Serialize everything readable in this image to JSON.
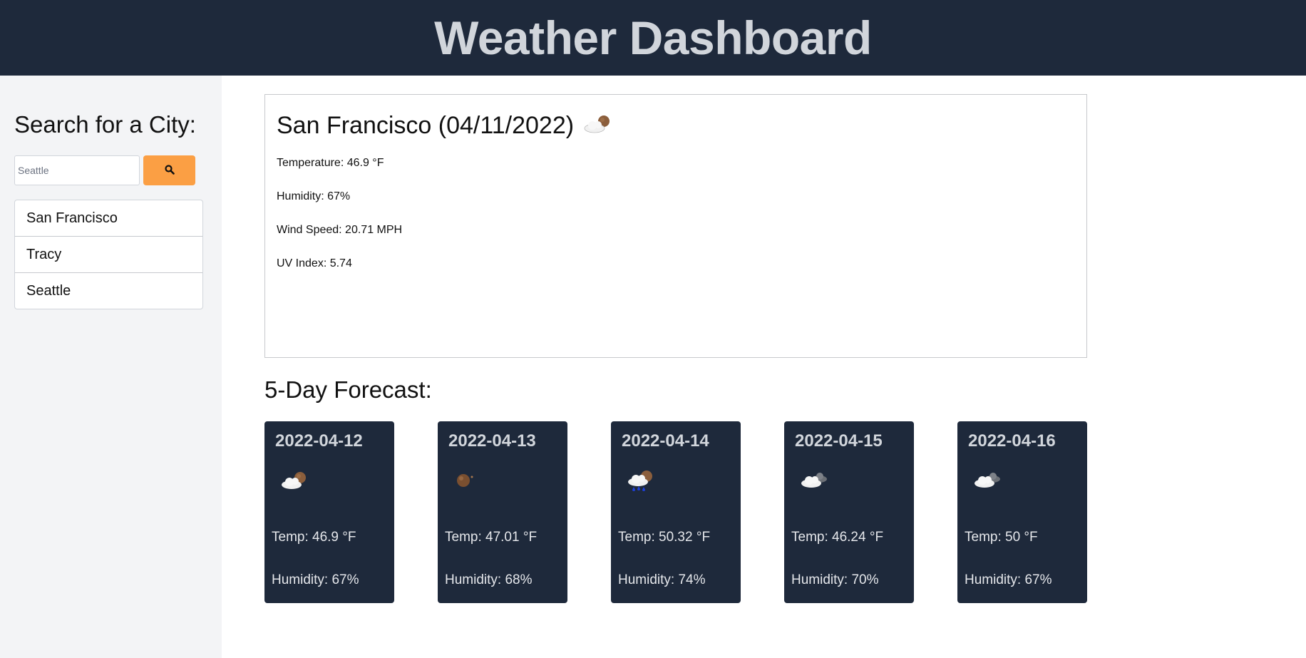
{
  "header": {
    "title": "Weather Dashboard"
  },
  "sidebar": {
    "heading": "Search for a City:",
    "search": {
      "value": "",
      "placeholder": "Seattle"
    },
    "search_button_icon": "search-icon",
    "history": [
      {
        "label": "San Francisco"
      },
      {
        "label": "Tracy"
      },
      {
        "label": "Seattle"
      }
    ]
  },
  "current": {
    "title": "San Francisco (04/11/2022)",
    "icon": "partly-cloudy-night-icon",
    "temperature": "Temperature: 46.9 °F",
    "humidity": "Humidity: 67%",
    "wind": "Wind Speed: 20.71 MPH",
    "uv": "UV Index: 5.74"
  },
  "forecast": {
    "heading": "5-Day Forecast:",
    "days": [
      {
        "date": "2022-04-12",
        "icon": "partly-cloudy-night-icon",
        "temp": "Temp: 46.9 °F",
        "humidity": "Humidity: 67%"
      },
      {
        "date": "2022-04-13",
        "icon": "clear-night-icon",
        "temp": "Temp: 47.01 °F",
        "humidity": "Humidity: 68%"
      },
      {
        "date": "2022-04-14",
        "icon": "rain-night-icon",
        "temp": "Temp: 50.32 °F",
        "humidity": "Humidity: 74%"
      },
      {
        "date": "2022-04-15",
        "icon": "broken-clouds-icon",
        "temp": "Temp: 46.24 °F",
        "humidity": "Humidity: 70%"
      },
      {
        "date": "2022-04-16",
        "icon": "broken-clouds-icon",
        "temp": "Temp: 50 °F",
        "humidity": "Humidity: 67%"
      }
    ]
  },
  "colors": {
    "header_bg": "#1e293b",
    "accent": "#fb9f44",
    "sidebar_bg": "#f3f4f6",
    "card_bg": "#1e293b"
  }
}
